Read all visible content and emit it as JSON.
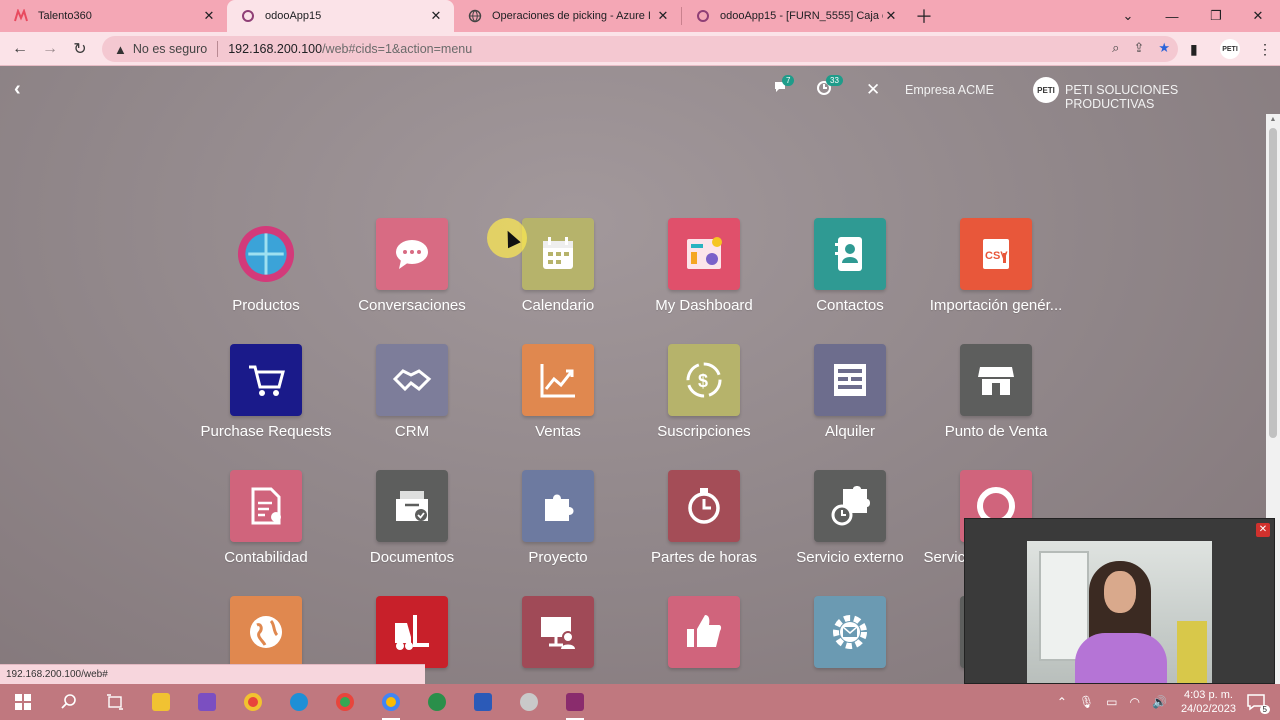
{
  "browser": {
    "tabs": [
      {
        "title": "Talento360",
        "favicon": "talento-icon",
        "active": false
      },
      {
        "title": "odooApp15",
        "favicon": "odoo-icon",
        "active": true
      },
      {
        "title": "Operaciones de picking - Azure I",
        "favicon": "globe-icon",
        "active": false
      },
      {
        "title": "odooApp15 - [FURN_5555] Caja c",
        "favicon": "odoo-icon",
        "active": false
      }
    ],
    "address": {
      "security_label": "No es seguro",
      "url_host": "192.168.200.100",
      "url_path": "/web#cids=1&action=menu"
    },
    "status_url": "192.168.200.100/web#"
  },
  "odoo": {
    "chat_count": "7",
    "activity_count": "33",
    "company": "Empresa ACME",
    "user_company": "PETI SOLUCIONES PRODUCTIVAS",
    "logo_text": "PETI"
  },
  "apps": [
    {
      "label": "Productos",
      "color": "#8e8486",
      "icon": "products-globe-icon"
    },
    {
      "label": "Conversaciones",
      "color": "#d86b83",
      "icon": "chat-bubble-icon"
    },
    {
      "label": "Calendario",
      "color": "#b6b36b",
      "icon": "calendar-icon"
    },
    {
      "label": "My Dashboard",
      "color": "#e0506b",
      "icon": "dashboard-icon"
    },
    {
      "label": "Contactos",
      "color": "#2f9a93",
      "icon": "contact-card-icon"
    },
    {
      "label": "Importación genér...",
      "color": "#e8573a",
      "icon": "csv-icon"
    },
    {
      "label": "Purchase Requests",
      "color": "#1a1a8a",
      "icon": "cart-icon"
    },
    {
      "label": "CRM",
      "color": "#7d7d9a",
      "icon": "handshake-icon"
    },
    {
      "label": "Ventas",
      "color": "#e0884f",
      "icon": "chart-up-icon"
    },
    {
      "label": "Suscripciones",
      "color": "#b6b36b",
      "icon": "dollar-cycle-icon"
    },
    {
      "label": "Alquiler",
      "color": "#6d6d8d",
      "icon": "calendar-grid-icon"
    },
    {
      "label": "Punto de Venta",
      "color": "#5d5e5d",
      "icon": "store-icon"
    },
    {
      "label": "Contabilidad",
      "color": "#d0647c",
      "icon": "document-gear-icon"
    },
    {
      "label": "Documentos",
      "color": "#5d5e5d",
      "icon": "inbox-check-icon"
    },
    {
      "label": "Proyecto",
      "color": "#6d7aa0",
      "icon": "puzzle-icon"
    },
    {
      "label": "Partes de horas",
      "color": "#a44d57",
      "icon": "stopwatch-icon"
    },
    {
      "label": "Servicio externo",
      "color": "#5d5e5d",
      "icon": "puzzle-clock-icon"
    },
    {
      "label": "Servicio de asistencia",
      "color": "#d0647c",
      "icon": "lifebuoy-icon"
    },
    {
      "label": "",
      "color": "#e0884f",
      "icon": "globe-icon"
    },
    {
      "label": "",
      "color": "#c8202a",
      "icon": "forklift-icon"
    },
    {
      "label": "",
      "color": "#a04a57",
      "icon": "presentation-icon"
    },
    {
      "label": "",
      "color": "#d0647c",
      "icon": "thumbs-up-icon"
    },
    {
      "label": "",
      "color": "#6b9ab2",
      "icon": "gear-mail-icon"
    },
    {
      "label": "",
      "color": "#5d5e5d",
      "icon": "unknown-icon"
    }
  ],
  "taskbar": {
    "time": "4:03 p. m.",
    "date": "24/02/2023",
    "notifications": "5"
  }
}
